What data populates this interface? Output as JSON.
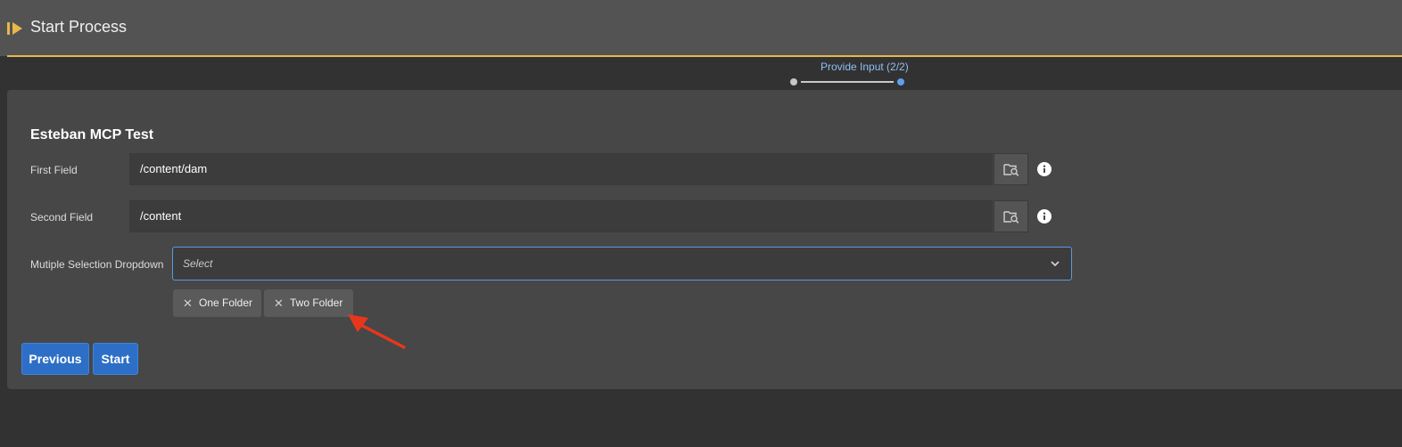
{
  "header": {
    "title": "Start Process",
    "accent_color": "#e8b84b"
  },
  "stepper": {
    "label": "Provide Input (2/2)",
    "current_step": 2,
    "total_steps": 2
  },
  "form": {
    "title": "Esteban MCP Test",
    "first_field": {
      "label": "First Field",
      "value": "/content/dam"
    },
    "second_field": {
      "label": "Second Field",
      "value": "/content"
    },
    "dropdown": {
      "label": "Mutiple Selection Dropdown",
      "placeholder": "Select",
      "selected_tags": [
        "One Folder",
        "Two Folder"
      ]
    }
  },
  "actions": {
    "previous_label": "Previous",
    "start_label": "Start",
    "primary_color": "#2d6fc6"
  },
  "annotation": {
    "arrow_color": "#e8361c",
    "icon": "red-arrow-annotation"
  }
}
